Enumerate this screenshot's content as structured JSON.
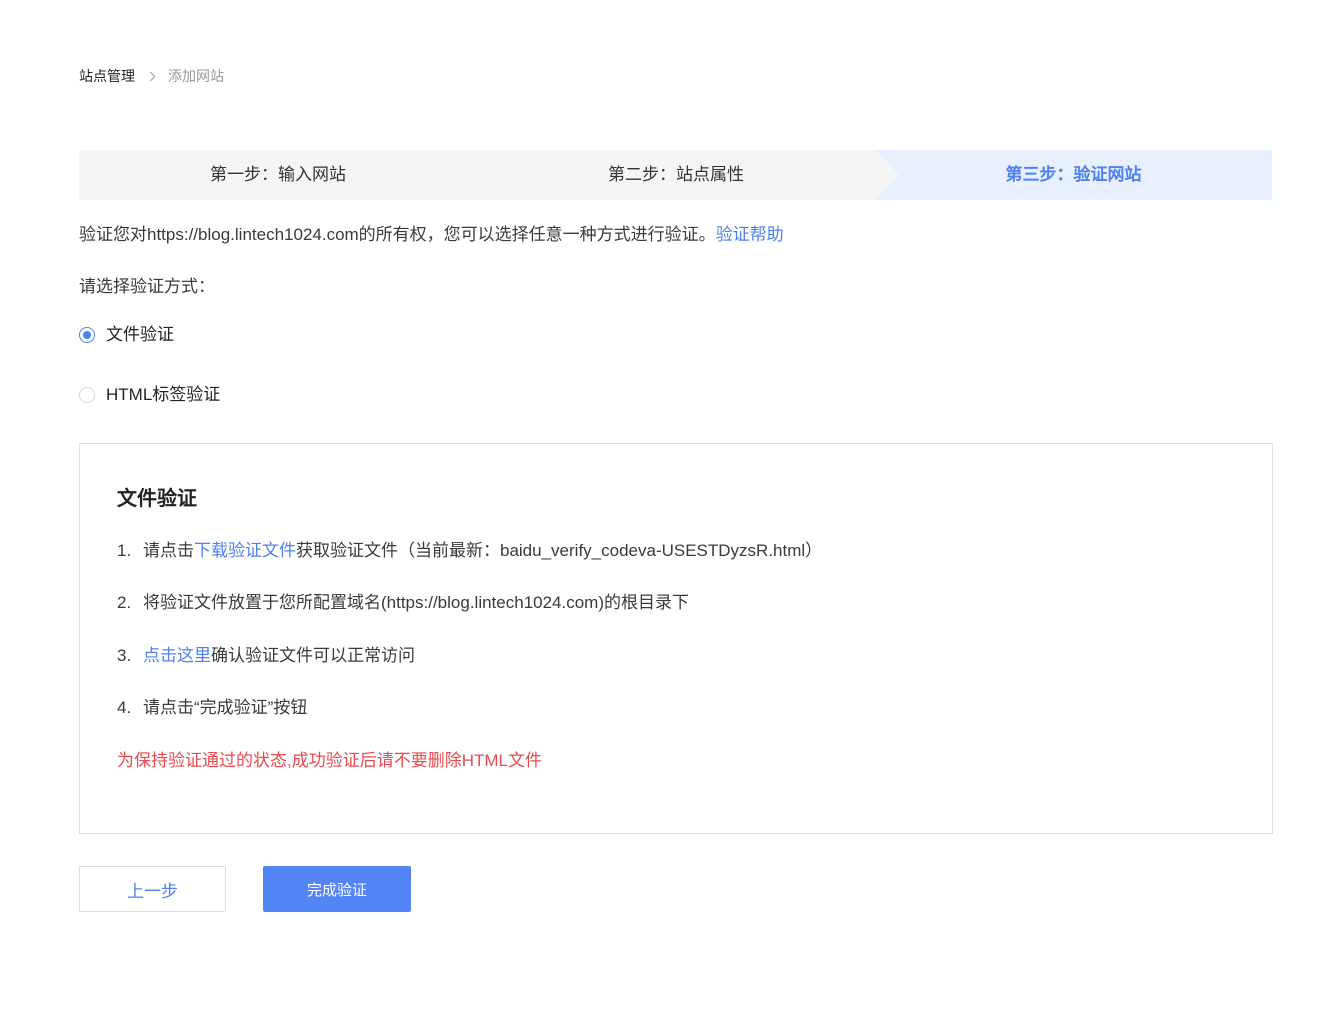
{
  "colors": {
    "accent": "#4e7ff3",
    "warning": "#e84a4f",
    "text": "#333333",
    "muted": "#999999",
    "step_bg": "#f5f5f5",
    "step_active_bg": "#e8f0fd",
    "primary_button": "#5485f6"
  },
  "icons": {
    "breadcrumb_separator": "chevron-right-icon"
  },
  "breadcrumb": {
    "parent": "站点管理",
    "current": "添加网站"
  },
  "steps": [
    {
      "label": "第一步：输入网站",
      "active": false
    },
    {
      "label": "第二步：站点属性",
      "active": false
    },
    {
      "label": "第三步：验证网站",
      "active": true
    }
  ],
  "intro": {
    "text": "验证您对https://blog.lintech1024.com的所有权，您可以选择任意一种方式进行验证。",
    "help_link": "验证帮助"
  },
  "method_prompt": "请选择验证方式：",
  "methods": [
    {
      "label": "文件验证",
      "selected": true
    },
    {
      "label": "HTML标签验证",
      "selected": false
    }
  ],
  "panel": {
    "title": "文件验证",
    "items": [
      {
        "number": "1.",
        "before": "请点击",
        "link": "下载验证文件",
        "after": "获取验证文件（当前最新：baidu_verify_codeva-USESTDyzsR.html）"
      },
      {
        "number": "2.",
        "before": "将验证文件放置于您所配置域名(https://blog.lintech1024.com)的根目录下"
      },
      {
        "number": "3.",
        "link": "点击这里",
        "after": "确认验证文件可以正常访问"
      },
      {
        "number": "4.",
        "before": "请点击“完成验证”按钮"
      }
    ],
    "warning": "为保持验证通过的状态,成功验证后请不要删除HTML文件"
  },
  "buttons": {
    "prev": "上一步",
    "done": "完成验证"
  }
}
